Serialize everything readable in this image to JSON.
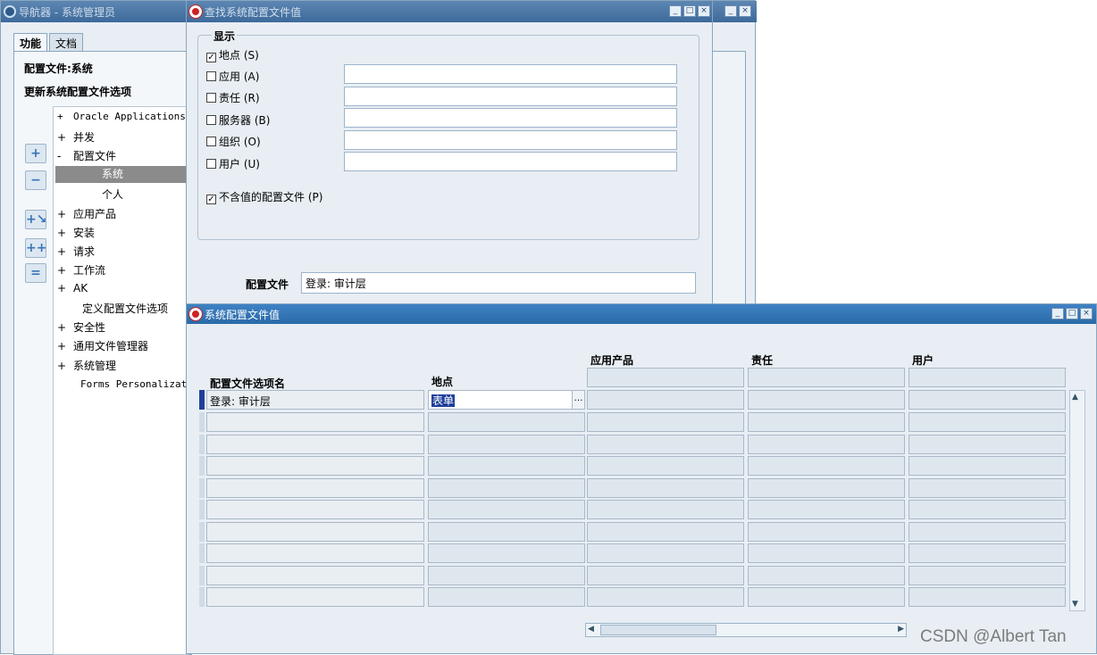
{
  "navigator": {
    "title": "导航器 - 系统管理员",
    "tabs": [
      "功能",
      "文档"
    ],
    "config_file_label": "配置文件:系统",
    "update_label": "更新系统配置文件选项",
    "tree": [
      {
        "sign": "+",
        "label": "Oracle Applications",
        "mono": true
      },
      {
        "sign": "+",
        "label": "并发"
      },
      {
        "sign": "-",
        "label": "配置文件"
      },
      {
        "sign": "",
        "label": "系统",
        "selected": true
      },
      {
        "sign": "",
        "label": "个人",
        "indent": true
      },
      {
        "sign": "+",
        "label": "应用产品"
      },
      {
        "sign": "+",
        "label": "安装"
      },
      {
        "sign": "+",
        "label": "请求"
      },
      {
        "sign": "+",
        "label": "工作流"
      },
      {
        "sign": "+",
        "label": "AK"
      },
      {
        "sign": "",
        "label": "定义配置文件选项",
        "indent_small": true
      },
      {
        "sign": "+",
        "label": "安全性"
      },
      {
        "sign": "+",
        "label": "通用文件管理器"
      },
      {
        "sign": "+",
        "label": "系统管理"
      },
      {
        "sign": "",
        "label": "Forms Personalization",
        "mono": true,
        "indent_small": true
      }
    ]
  },
  "find_dialog": {
    "title": "查找系统配置文件值",
    "group_label": "显示",
    "options": [
      {
        "label": "地点 (S)",
        "checked": true,
        "has_field": false
      },
      {
        "label": "应用 (A)",
        "checked": false,
        "has_field": true
      },
      {
        "label": "责任 (R)",
        "checked": false,
        "has_field": true
      },
      {
        "label": "服务器 (B)",
        "checked": false,
        "has_field": true
      },
      {
        "label": "组织 (O)",
        "checked": false,
        "has_field": true
      },
      {
        "label": "用户  (U)",
        "checked": false,
        "has_field": true
      }
    ],
    "no_value_option": {
      "label": "不含值的配置文件 (P)",
      "checked": true
    },
    "config_file_label": "配置文件",
    "config_file_value": "登录: 审计层"
  },
  "values_window": {
    "title": "系统配置文件值",
    "columns": {
      "option_name": "配置文件选项名",
      "site": "地点",
      "application": "应用产品",
      "responsibility": "责任",
      "user": "用户"
    },
    "rows": [
      {
        "option_name": "登录: 审计层",
        "site": "表单"
      }
    ],
    "empty_rows": 9
  },
  "watermark": "CSDN @Albert Tan",
  "colors": {
    "title_bar": "#3d6a9b",
    "active_title_bar": "#2b6aa8",
    "selection": "#8b8b8b",
    "highlight": "#1f3f9b"
  }
}
